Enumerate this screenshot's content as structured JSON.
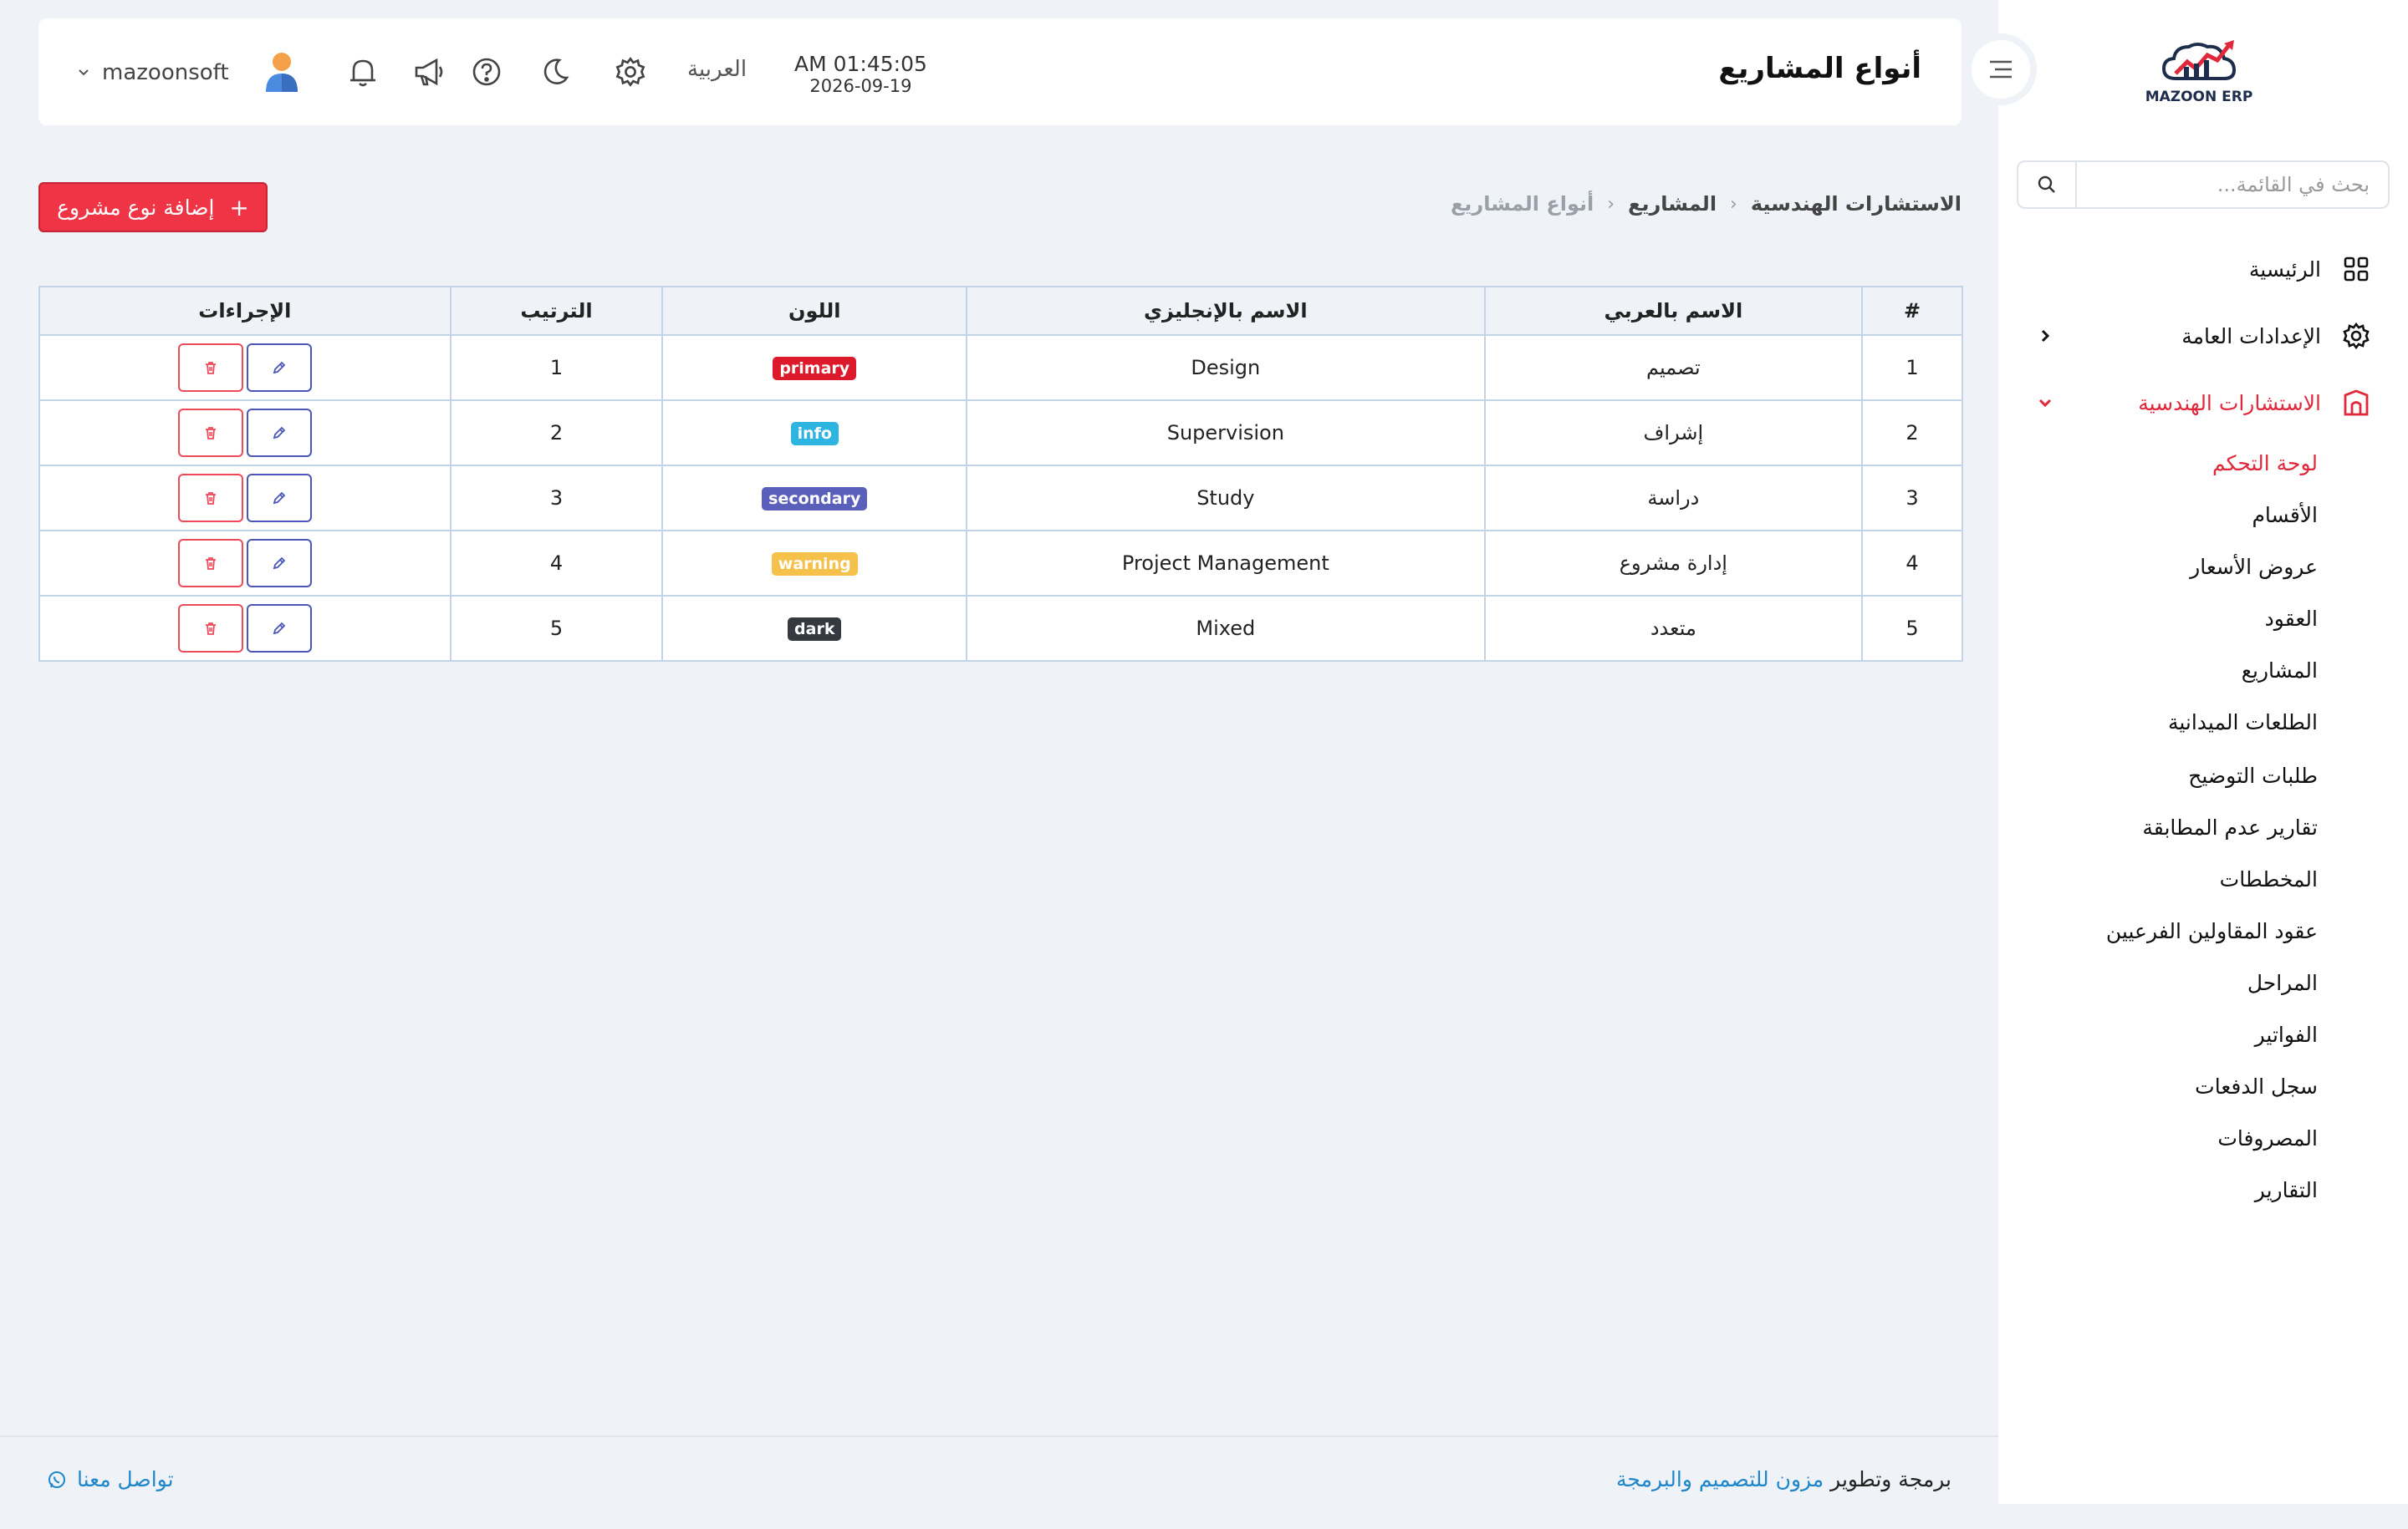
{
  "brand": {
    "name": "MAZOON ERP",
    "sub": "ERP"
  },
  "search": {
    "placeholder": "بحث في القائمة..."
  },
  "sidebar": {
    "items": [
      {
        "label": "الرئيسية",
        "icon": "grid-icon"
      },
      {
        "label": "الإعدادات العامة",
        "icon": "gear-icon"
      },
      {
        "label": "الاستشارات الهندسية",
        "icon": "building-icon"
      }
    ],
    "subitems": [
      "لوحة التحكم",
      "الأقسام",
      "عروض الأسعار",
      "العقود",
      "المشاريع",
      "الطلعات الميدانية",
      "طلبات التوضيح",
      "تقارير عدم المطابقة",
      "المخططات",
      "عقود المقاولين الفرعيين",
      "المراحل",
      "الفواتير",
      "سجل الدفعات",
      "المصروفات",
      "التقارير"
    ]
  },
  "header": {
    "title": "أنواع المشاريع",
    "time": "AM 01:45:05",
    "date": "2026-09-19",
    "language": "العربية",
    "username": "mazoonsoft"
  },
  "breadcrumb": {
    "level1": "الاستشارات الهندسية",
    "level2": "المشاريع",
    "current": "أنواع المشاريع"
  },
  "add_button": {
    "label": "إضافة نوع مشروع",
    "plus": "+"
  },
  "table": {
    "headers": {
      "num": "#",
      "name_ar": "الاسم بالعربي",
      "name_en": "الاسم بالإنجليزي",
      "color": "اللون",
      "order": "الترتيب",
      "actions": "الإجراءات"
    },
    "rows": [
      {
        "num": "1",
        "name_ar": "تصميم",
        "name_en": "Design",
        "color": "primary",
        "order": "1"
      },
      {
        "num": "2",
        "name_ar": "إشراف",
        "name_en": "Supervision",
        "color": "info",
        "order": "2"
      },
      {
        "num": "3",
        "name_ar": "دراسة",
        "name_en": "Study",
        "color": "secondary",
        "order": "3"
      },
      {
        "num": "4",
        "name_ar": "إدارة مشروع",
        "name_en": "Project Management",
        "color": "warning",
        "order": "4"
      },
      {
        "num": "5",
        "name_ar": "متعدد",
        "name_en": "Mixed",
        "color": "dark",
        "order": "5"
      }
    ]
  },
  "badge_colors": {
    "primary": "#dc1a2c",
    "info": "#2db4e0",
    "secondary": "#5b5fbc",
    "warning": "#f5c14a",
    "dark": "#343a40"
  },
  "accent_color": "#e0283b",
  "footer": {
    "prefix": "برمجة وتطوير",
    "link": "مزون للتصميم والبرمجة",
    "contact": "تواصل معنا"
  }
}
